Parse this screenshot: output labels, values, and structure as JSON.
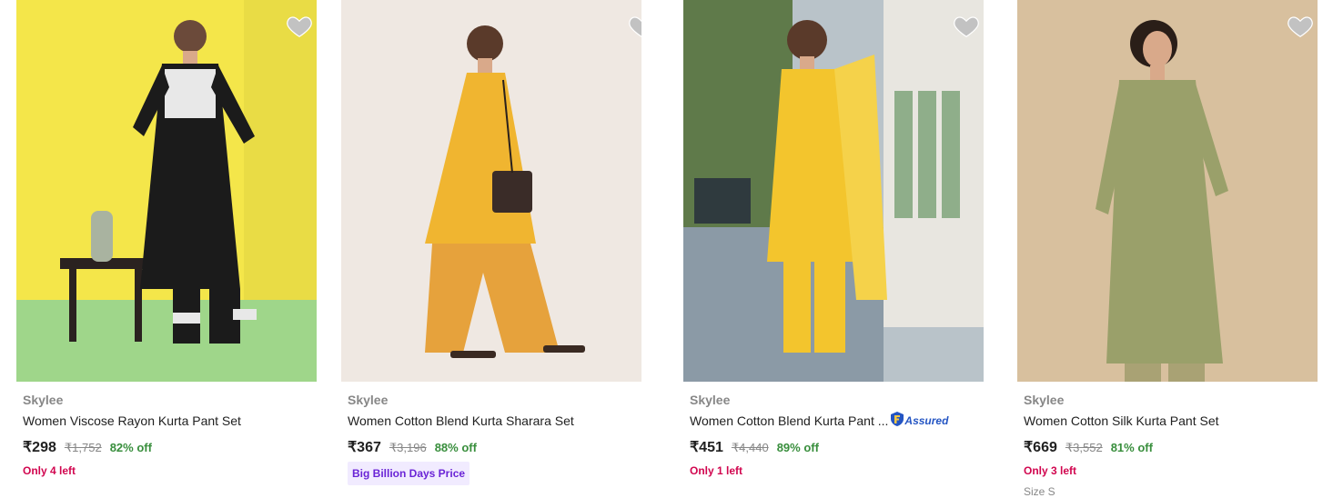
{
  "products": [
    {
      "brand": "Skylee",
      "title": "Women Viscose Rayon Kurta Pant Set",
      "price": "₹298",
      "mrp": "₹1,752",
      "discount": "82% off",
      "stock": "Only 4 left",
      "image_colors": {
        "bg": "#f4e64a",
        "floor": "#9fd68a",
        "garment": "#1b1b1b"
      }
    },
    {
      "brand": "Skylee",
      "title": "Women Cotton Blend Kurta Sharara Set",
      "price": "₹367",
      "mrp": "₹3,196",
      "discount": "88% off",
      "deal_badge": "Big Billion Days Price",
      "image_colors": {
        "bg": "#efe8e2",
        "garment": "#f0b530"
      }
    },
    {
      "brand": "Skylee",
      "title": "Women Cotton Blend Kurta Pant ...",
      "assured_label": "Assured",
      "price": "₹451",
      "mrp": "₹4,440",
      "discount": "89% off",
      "stock": "Only 1 left",
      "image_colors": {
        "bg": "#b9c3c9",
        "garment": "#f3c52d"
      }
    },
    {
      "brand": "Skylee",
      "title": "Women Cotton Silk Kurta Pant Set",
      "price": "₹669",
      "mrp": "₹3,552",
      "discount": "81% off",
      "stock": "Only 3 left",
      "size_hint": "Size S",
      "image_colors": {
        "bg": "#d8c09e",
        "garment": "#9aa06a"
      }
    }
  ],
  "colors": {
    "price_green": "#388e3c",
    "stock_red": "#d1064f",
    "assured_blue": "#2455c3",
    "deal_purple": "#6a24d6",
    "heart_grey": "#c2c2c2"
  },
  "icons": {
    "wishlist": "heart-icon",
    "assured": "flipkart-assured-shield-icon"
  }
}
